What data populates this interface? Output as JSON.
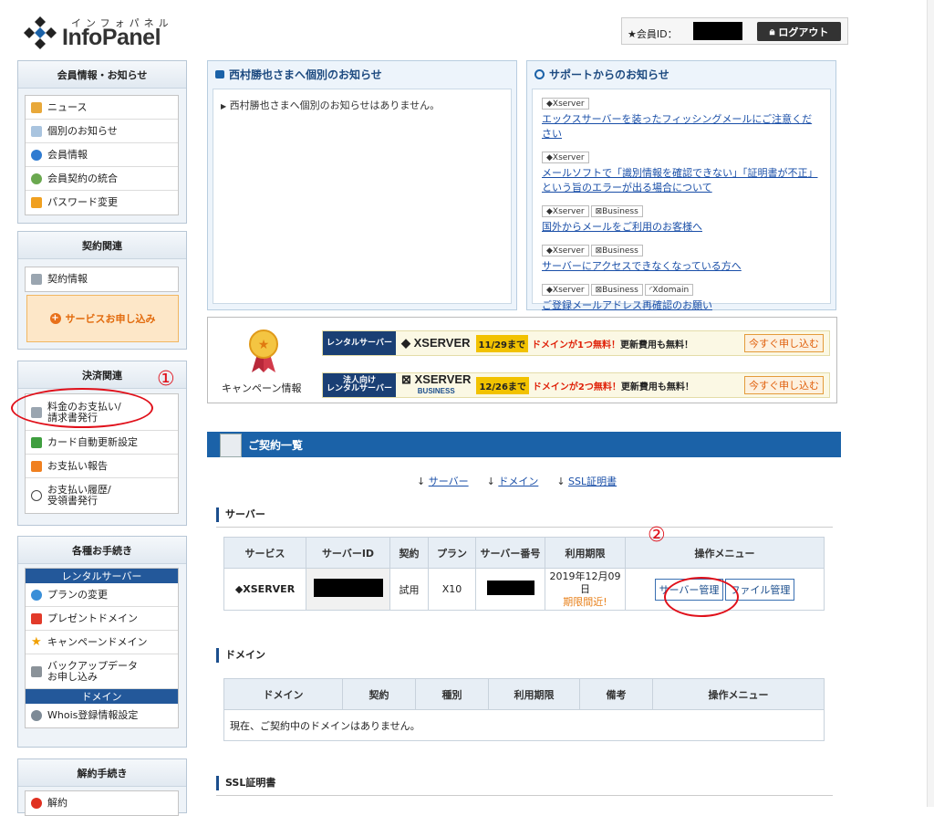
{
  "header": {
    "logo_kana": "インフォパネル",
    "logo_text": "InfoPanel",
    "member_label": "★会員ID：",
    "logout_label": "ログアウト"
  },
  "sidebar": {
    "member": {
      "title": "会員情報・お知らせ",
      "items": [
        {
          "label": "ニュース",
          "icon": "news-icon"
        },
        {
          "label": "個別のお知らせ",
          "icon": "notice-icon"
        },
        {
          "label": "会員情報",
          "icon": "user-icon"
        },
        {
          "label": "会員契約の統合",
          "icon": "merge-icon"
        },
        {
          "label": "パスワード変更",
          "icon": "lock-icon"
        }
      ]
    },
    "contract": {
      "title": "契約関連",
      "items": [
        {
          "label": "契約情報",
          "icon": "contract-icon"
        }
      ],
      "apply_label": "サービスお申し込み"
    },
    "payment": {
      "title": "決済関連",
      "items": [
        {
          "label": "料金のお支払い/\n請求書発行",
          "icon": "invoice-icon"
        },
        {
          "label": "カード自動更新設定",
          "icon": "card-icon"
        },
        {
          "label": "お支払い報告",
          "icon": "report-icon"
        },
        {
          "label": "お支払い履歴/\n受領書発行",
          "icon": "history-icon"
        }
      ]
    },
    "procedures": {
      "title": "各種お手続き",
      "cat_rental": "レンタルサーバー",
      "rental_items": [
        {
          "label": "プランの変更",
          "icon": "plan-icon"
        },
        {
          "label": "プレゼントドメイン",
          "icon": "gift-icon"
        },
        {
          "label": "キャンペーンドメイン",
          "icon": "star-icon"
        },
        {
          "label": "バックアップデータ\nお申し込み",
          "icon": "backup-icon"
        }
      ],
      "cat_domain": "ドメイン",
      "domain_items": [
        {
          "label": "Whois登録情報設定",
          "icon": "whois-icon"
        }
      ]
    },
    "cancel": {
      "title": "解約手続き",
      "items": [
        {
          "label": "解約",
          "icon": "cancel-icon"
        }
      ]
    }
  },
  "personal_notice": {
    "title": "西村勝也さまへ個別のお知らせ",
    "text": "西村勝也さまへ個別のお知らせはありません。"
  },
  "support_notice": {
    "title": "サポートからのお知らせ",
    "items": [
      {
        "tags": [
          "Xserver"
        ],
        "text": "エックスサーバーを装ったフィッシングメールにご注意ください"
      },
      {
        "tags": [
          "Xserver"
        ],
        "text": "メールソフトで「識別情報を確認できない」「証明書が不正」という旨のエラーが出る場合について"
      },
      {
        "tags": [
          "Xserver",
          "Business"
        ],
        "text": "国外からメールをご利用のお客様へ"
      },
      {
        "tags": [
          "Xserver",
          "Business"
        ],
        "text": "サーバーにアクセスできなくなっている方へ"
      },
      {
        "tags": [
          "Xserver",
          "Business",
          "Xdomain"
        ],
        "text": "ご登録メールアドレス再確認のお願い"
      }
    ]
  },
  "campaign": {
    "label": "キャンペーン情報",
    "rows": [
      {
        "tag": "レンタルサーバー",
        "logo": "XSERVER",
        "logo_sub": "",
        "date": "11/29まで",
        "msg": "ドメインが1つ無料！",
        "msg2": "更新費用も無料！",
        "button": "今すぐ申し込む"
      },
      {
        "tag": "法人向け\nレンタルサーバー",
        "logo": "XSERVER",
        "logo_sub": "BUSINESS",
        "date": "12/26まで",
        "msg": "ドメインが2つ無料！",
        "msg2": "更新費用も無料！",
        "button": "今すぐ申し込む"
      }
    ]
  },
  "contracts": {
    "title": "ご契約一覧",
    "anchors": [
      "サーバー",
      "ドメイン",
      "SSL証明書"
    ],
    "server": {
      "title": "サーバー",
      "headers": [
        "サービス",
        "サーバーID",
        "契約",
        "プラン",
        "サーバー番号",
        "利用期限",
        "操作メニュー"
      ],
      "row": {
        "service": "XSERVER",
        "type": "試用",
        "plan": "X10",
        "expiry": "2019年12月09日",
        "expiry_note": "期限間近!",
        "btn_manage": "サーバー管理",
        "btn_file": "ファイル管理"
      }
    },
    "domain": {
      "title": "ドメイン",
      "headers": [
        "ドメイン",
        "契約",
        "種別",
        "利用期限",
        "備考",
        "操作メニュー"
      ],
      "empty": "現在、ご契約中のドメインはありません。"
    },
    "ssl": {
      "title": "SSL証明書"
    }
  },
  "annotations": {
    "mark1": "①",
    "mark2": "②"
  },
  "colors": {
    "accent": "#1b62a8",
    "annotation": "#e0101a"
  }
}
